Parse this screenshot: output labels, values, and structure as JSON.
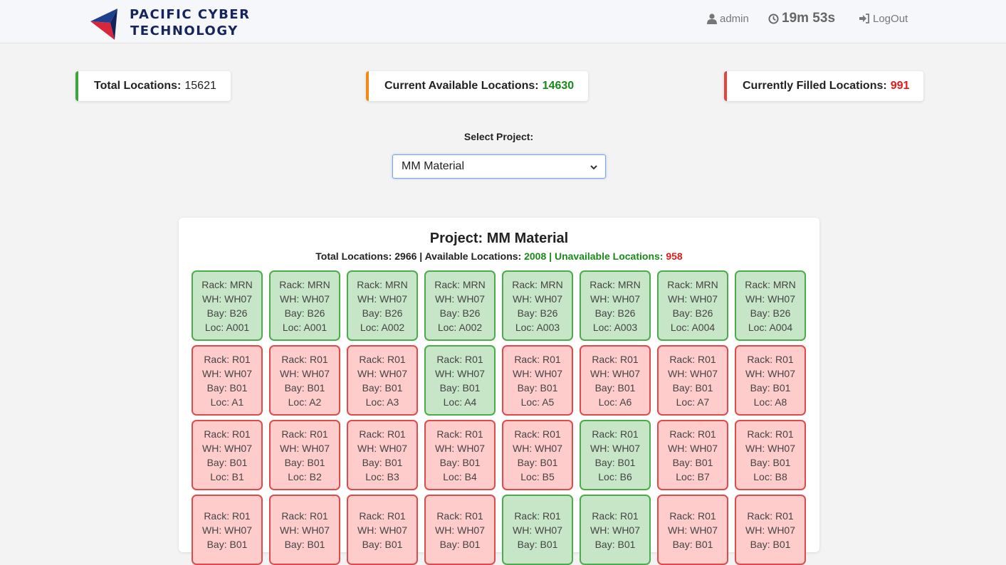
{
  "header": {
    "logo_line1": "PACIFIC CYBER",
    "logo_line2": "TECHNOLOGY",
    "user": "admin",
    "timer": "19m 53s",
    "logout": "LogOut"
  },
  "stats": {
    "total_label": "Total Locations:",
    "total_value": "15621",
    "available_label": "Current Available Locations:",
    "available_value": "14630",
    "filled_label": "Currently Filled Locations:",
    "filled_value": "991"
  },
  "colors": {
    "available": "#188a18",
    "filled": "#e01b1b"
  },
  "project_select": {
    "label": "Select Project:",
    "value": "MM Material"
  },
  "panel": {
    "title": "Project: MM Material",
    "total_label": "Total Locations:",
    "total_value": "2966",
    "sep": "|",
    "available_label": "Available Locations:",
    "available_value": "2008",
    "unavailable_label": "Unavailable Locations:",
    "unavailable_value": "958"
  },
  "locations": [
    {
      "rack": "Rack: MRN",
      "wh": "WH: WH07",
      "bay": "Bay: B26",
      "loc": "Loc: A001",
      "status": "available"
    },
    {
      "rack": "Rack: MRN",
      "wh": "WH: WH07",
      "bay": "Bay: B26",
      "loc": "Loc: A001",
      "status": "available"
    },
    {
      "rack": "Rack: MRN",
      "wh": "WH: WH07",
      "bay": "Bay: B26",
      "loc": "Loc: A002",
      "status": "available"
    },
    {
      "rack": "Rack: MRN",
      "wh": "WH: WH07",
      "bay": "Bay: B26",
      "loc": "Loc: A002",
      "status": "available"
    },
    {
      "rack": "Rack: MRN",
      "wh": "WH: WH07",
      "bay": "Bay: B26",
      "loc": "Loc: A003",
      "status": "available"
    },
    {
      "rack": "Rack: MRN",
      "wh": "WH: WH07",
      "bay": "Bay: B26",
      "loc": "Loc: A003",
      "status": "available"
    },
    {
      "rack": "Rack: MRN",
      "wh": "WH: WH07",
      "bay": "Bay: B26",
      "loc": "Loc: A004",
      "status": "available"
    },
    {
      "rack": "Rack: MRN",
      "wh": "WH: WH07",
      "bay": "Bay: B26",
      "loc": "Loc: A004",
      "status": "available"
    },
    {
      "rack": "Rack: R01",
      "wh": "WH: WH07",
      "bay": "Bay: B01",
      "loc": "Loc: A1",
      "status": "filled"
    },
    {
      "rack": "Rack: R01",
      "wh": "WH: WH07",
      "bay": "Bay: B01",
      "loc": "Loc: A2",
      "status": "filled"
    },
    {
      "rack": "Rack: R01",
      "wh": "WH: WH07",
      "bay": "Bay: B01",
      "loc": "Loc: A3",
      "status": "filled"
    },
    {
      "rack": "Rack: R01",
      "wh": "WH: WH07",
      "bay": "Bay: B01",
      "loc": "Loc: A4",
      "status": "available"
    },
    {
      "rack": "Rack: R01",
      "wh": "WH: WH07",
      "bay": "Bay: B01",
      "loc": "Loc: A5",
      "status": "filled"
    },
    {
      "rack": "Rack: R01",
      "wh": "WH: WH07",
      "bay": "Bay: B01",
      "loc": "Loc: A6",
      "status": "filled"
    },
    {
      "rack": "Rack: R01",
      "wh": "WH: WH07",
      "bay": "Bay: B01",
      "loc": "Loc: A7",
      "status": "filled"
    },
    {
      "rack": "Rack: R01",
      "wh": "WH: WH07",
      "bay": "Bay: B01",
      "loc": "Loc: A8",
      "status": "filled"
    },
    {
      "rack": "Rack: R01",
      "wh": "WH: WH07",
      "bay": "Bay: B01",
      "loc": "Loc: B1",
      "status": "filled"
    },
    {
      "rack": "Rack: R01",
      "wh": "WH: WH07",
      "bay": "Bay: B01",
      "loc": "Loc: B2",
      "status": "filled"
    },
    {
      "rack": "Rack: R01",
      "wh": "WH: WH07",
      "bay": "Bay: B01",
      "loc": "Loc: B3",
      "status": "filled"
    },
    {
      "rack": "Rack: R01",
      "wh": "WH: WH07",
      "bay": "Bay: B01",
      "loc": "Loc: B4",
      "status": "filled"
    },
    {
      "rack": "Rack: R01",
      "wh": "WH: WH07",
      "bay": "Bay: B01",
      "loc": "Loc: B5",
      "status": "filled"
    },
    {
      "rack": "Rack: R01",
      "wh": "WH: WH07",
      "bay": "Bay: B01",
      "loc": "Loc: B6",
      "status": "available"
    },
    {
      "rack": "Rack: R01",
      "wh": "WH: WH07",
      "bay": "Bay: B01",
      "loc": "Loc: B7",
      "status": "filled"
    },
    {
      "rack": "Rack: R01",
      "wh": "WH: WH07",
      "bay": "Bay: B01",
      "loc": "Loc: B8",
      "status": "filled"
    },
    {
      "rack": "Rack: R01",
      "wh": "WH: WH07",
      "bay": "Bay: B01",
      "loc": "",
      "status": "filled"
    },
    {
      "rack": "Rack: R01",
      "wh": "WH: WH07",
      "bay": "Bay: B01",
      "loc": "",
      "status": "filled"
    },
    {
      "rack": "Rack: R01",
      "wh": "WH: WH07",
      "bay": "Bay: B01",
      "loc": "",
      "status": "filled"
    },
    {
      "rack": "Rack: R01",
      "wh": "WH: WH07",
      "bay": "Bay: B01",
      "loc": "",
      "status": "filled"
    },
    {
      "rack": "Rack: R01",
      "wh": "WH: WH07",
      "bay": "Bay: B01",
      "loc": "",
      "status": "available"
    },
    {
      "rack": "Rack: R01",
      "wh": "WH: WH07",
      "bay": "Bay: B01",
      "loc": "",
      "status": "available"
    },
    {
      "rack": "Rack: R01",
      "wh": "WH: WH07",
      "bay": "Bay: B01",
      "loc": "",
      "status": "filled"
    },
    {
      "rack": "Rack: R01",
      "wh": "WH: WH07",
      "bay": "Bay: B01",
      "loc": "",
      "status": "filled"
    }
  ]
}
